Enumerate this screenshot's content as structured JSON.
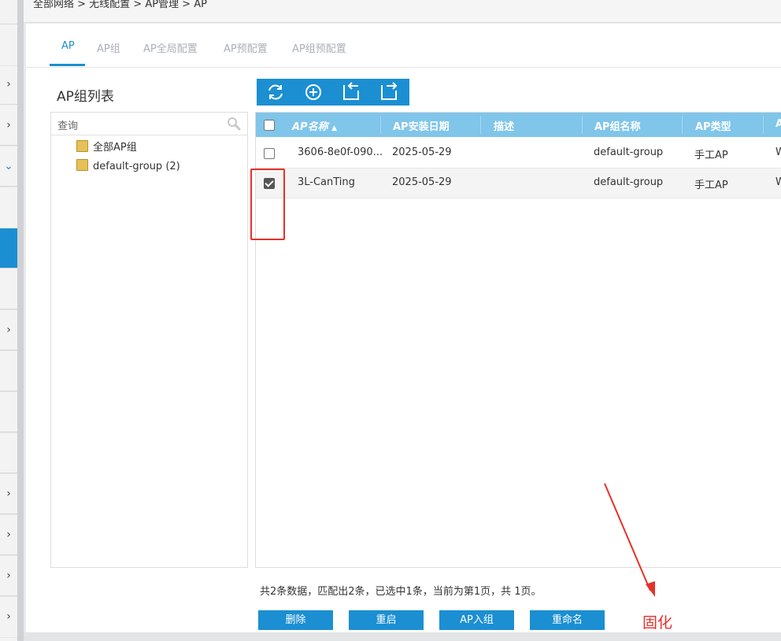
{
  "breadcrumb": "全部网络 > 无线配置 > AP管理 > AP",
  "tabs": [
    {
      "label": "AP",
      "active": true
    },
    {
      "label": "AP组",
      "active": false
    },
    {
      "label": "AP全局配置",
      "active": false
    },
    {
      "label": "AP预配置",
      "active": false
    },
    {
      "label": "AP组预配置",
      "active": false
    }
  ],
  "group_panel": {
    "title": "AP组列表",
    "search_placeholder": "查询",
    "items": [
      {
        "label": "全部AP组",
        "icon": "folder-icon"
      },
      {
        "label": "default-group (2)",
        "icon": "folder-icon"
      }
    ]
  },
  "toolbar": {
    "buttons": [
      "refresh-icon",
      "add-icon",
      "import-icon",
      "export-icon"
    ]
  },
  "table": {
    "columns": [
      "AP名称",
      "AP安装日期",
      "描述",
      "AP组名称",
      "AP类型",
      "A"
    ],
    "sort_column": "AP名称",
    "rows": [
      {
        "checked": false,
        "name": "3606-8e0f-090...",
        "install_date": "2025-05-29",
        "description": "",
        "group": "default-group",
        "type": "手工AP",
        "extra": "W"
      },
      {
        "checked": true,
        "name": "3L-CanTing",
        "install_date": "2025-05-29",
        "description": "",
        "group": "default-group",
        "type": "手工AP",
        "extra": "W"
      }
    ]
  },
  "footer": {
    "summary": "共2条数据，匹配出2条，已选中1条，当前为第1页，共 1页。",
    "buttons": [
      "删除",
      "重启",
      "AP入组",
      "重命名"
    ]
  },
  "annotation": "固化",
  "colors": {
    "accent": "#1b8fd2",
    "header": "#80c5ea",
    "annotation_red": "#e8302a"
  }
}
